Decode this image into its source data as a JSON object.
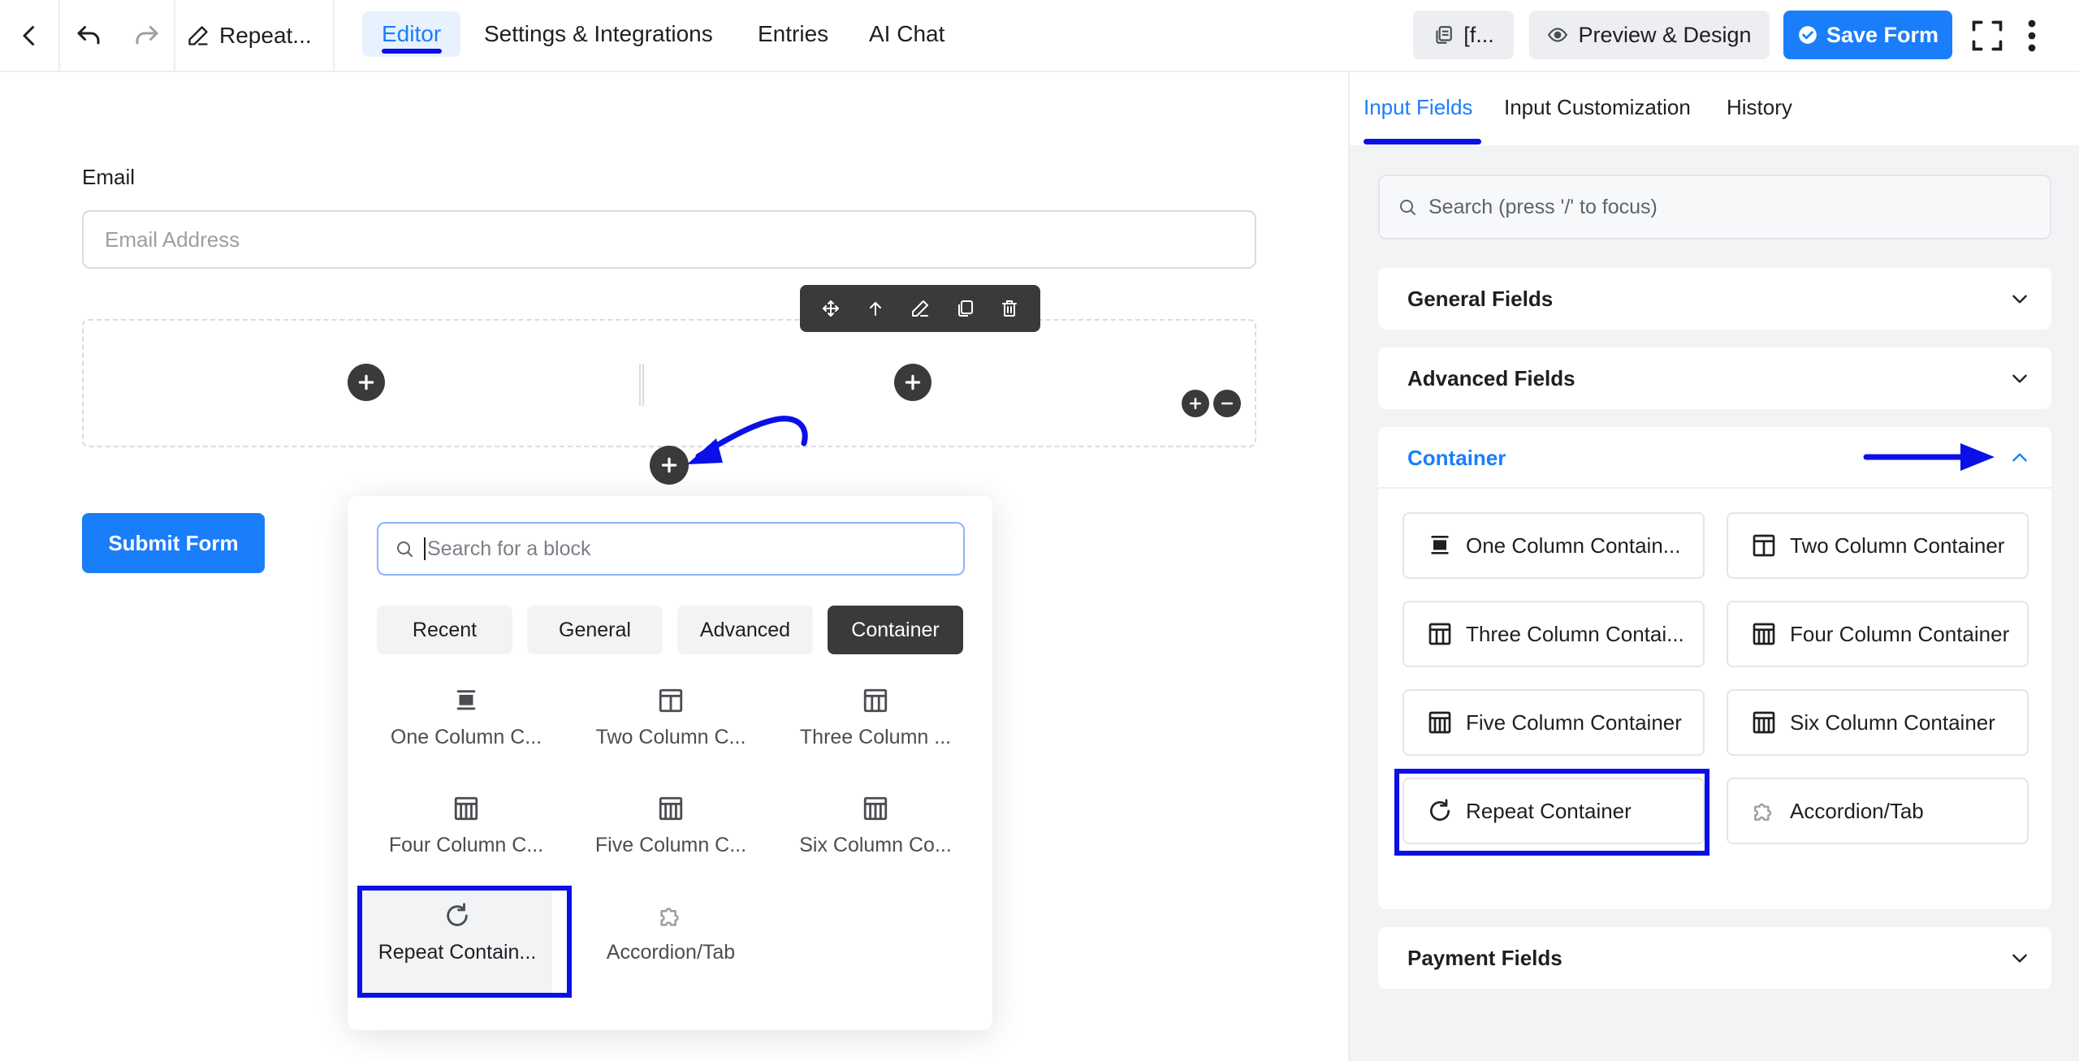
{
  "topbar": {
    "form_name": "Repeat...",
    "tabs": [
      "Editor",
      "Settings & Integrations",
      "Entries",
      "AI Chat"
    ],
    "shortcode_label": "[f...",
    "preview_label": "Preview & Design",
    "save_label": "Save Form"
  },
  "editor": {
    "email_label": "Email",
    "email_placeholder": "Email Address",
    "submit_label": "Submit Form"
  },
  "popup": {
    "search_placeholder": "Search for a block",
    "categories": [
      "Recent",
      "General",
      "Advanced",
      "Container"
    ],
    "active_category": "Container",
    "blocks": [
      {
        "label": "One Column C...",
        "icon": "one-column-icon"
      },
      {
        "label": "Two Column C...",
        "icon": "two-column-icon"
      },
      {
        "label": "Three Column ...",
        "icon": "three-column-icon"
      },
      {
        "label": "Four Column C...",
        "icon": "four-column-icon"
      },
      {
        "label": "Five Column C...",
        "icon": "five-column-icon"
      },
      {
        "label": "Six Column Co...",
        "icon": "six-column-icon"
      },
      {
        "label": "Repeat Contain...",
        "icon": "repeat-icon"
      },
      {
        "label": "Accordion/Tab",
        "icon": "puzzle-icon"
      }
    ]
  },
  "right_panel": {
    "tabs": [
      "Input Fields",
      "Input Customization",
      "History"
    ],
    "search_placeholder": "Search (press '/' to focus)",
    "sections": {
      "general": "General Fields",
      "advanced": "Advanced Fields",
      "container": "Container",
      "payment": "Payment Fields"
    },
    "container_items": [
      {
        "label": "One Column Contain...",
        "icon": "one-column-icon"
      },
      {
        "label": "Two Column Container",
        "icon": "two-column-icon"
      },
      {
        "label": "Three Column Contai...",
        "icon": "three-column-icon"
      },
      {
        "label": "Four Column Container",
        "icon": "four-column-icon"
      },
      {
        "label": "Five Column Container",
        "icon": "five-column-icon"
      },
      {
        "label": "Six Column Container",
        "icon": "six-column-icon"
      },
      {
        "label": "Repeat Container",
        "icon": "repeat-icon"
      },
      {
        "label": "Accordion/Tab",
        "icon": "puzzle-icon"
      }
    ]
  },
  "colors": {
    "accent": "#1a7efb",
    "annotation": "#0b10e6",
    "dark": "#3a3a3c"
  }
}
